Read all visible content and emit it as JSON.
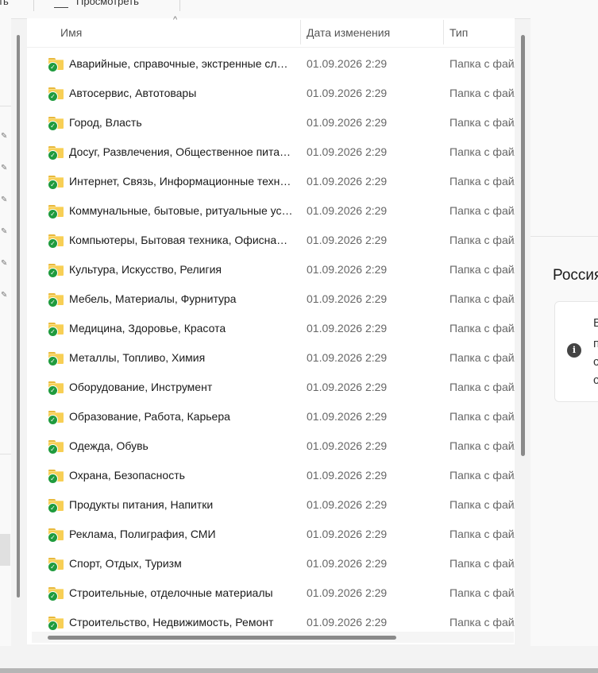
{
  "toolbar": {
    "left_label": "ть",
    "view_label": "Просмотреть"
  },
  "columns": {
    "name": "Имя",
    "date": "Дата изменения",
    "type": "Тип"
  },
  "rows": [
    {
      "name": "Аварийные, справочные, экстренные службы",
      "date": "01.09.2026 2:29",
      "type": "Папка с файлами"
    },
    {
      "name": "Автосервис, Автотовары",
      "date": "01.09.2026 2:29",
      "type": "Папка с файлами"
    },
    {
      "name": "Город, Власть",
      "date": "01.09.2026 2:29",
      "type": "Папка с файлами"
    },
    {
      "name": "Досуг, Развлечения, Общественное питание",
      "date": "01.09.2026 2:29",
      "type": "Папка с файлами"
    },
    {
      "name": "Интернет, Связь, Информационные технологии",
      "date": "01.09.2026 2:29",
      "type": "Папка с файлами"
    },
    {
      "name": "Коммунальные, бытовые, ритуальные услуги",
      "date": "01.09.2026 2:29",
      "type": "Папка с файлами"
    },
    {
      "name": "Компьютеры, Бытовая техника, Офисная техника",
      "date": "01.09.2026 2:29",
      "type": "Папка с файлами"
    },
    {
      "name": "Культура, Искусство, Религия",
      "date": "01.09.2026 2:29",
      "type": "Папка с файлами"
    },
    {
      "name": "Мебель, Материалы, Фурнитура",
      "date": "01.09.2026 2:29",
      "type": "Папка с файлами"
    },
    {
      "name": "Медицина, Здоровье, Красота",
      "date": "01.09.2026 2:29",
      "type": "Папка с файлами"
    },
    {
      "name": "Металлы, Топливо, Химия",
      "date": "01.09.2026 2:29",
      "type": "Папка с файлами"
    },
    {
      "name": "Оборудование, Инструмент",
      "date": "01.09.2026 2:29",
      "type": "Папка с файлами"
    },
    {
      "name": "Образование, Работа, Карьера",
      "date": "01.09.2026 2:29",
      "type": "Папка с файлами"
    },
    {
      "name": "Одежда, Обувь",
      "date": "01.09.2026 2:29",
      "type": "Папка с файлами"
    },
    {
      "name": "Охрана, Безопасность",
      "date": "01.09.2026 2:29",
      "type": "Папка с файлами"
    },
    {
      "name": "Продукты питания, Напитки",
      "date": "01.09.2026 2:29",
      "type": "Папка с файлами"
    },
    {
      "name": "Реклама, Полиграфия, СМИ",
      "date": "01.09.2026 2:29",
      "type": "Папка с файлами"
    },
    {
      "name": "Спорт, Отдых, Туризм",
      "date": "01.09.2026 2:29",
      "type": "Папка с файлами"
    },
    {
      "name": "Строительные, отделочные материалы",
      "date": "01.09.2026 2:29",
      "type": "Папка с файлами"
    },
    {
      "name": "Строительство, Недвижимость, Ремонт",
      "date": "01.09.2026 2:29",
      "type": "Папка с файлами"
    }
  ],
  "details": {
    "region_title": "Россия",
    "info_icon": "info-icon",
    "info_letters": [
      "В",
      "п",
      "с",
      "с"
    ]
  },
  "icons": {
    "folder": "folder-synced-icon",
    "pin": "pin-icon",
    "sort": "sort-ascending-icon"
  },
  "colors": {
    "folder": "#f7cf55",
    "sync_check": "#1f9b3e"
  }
}
